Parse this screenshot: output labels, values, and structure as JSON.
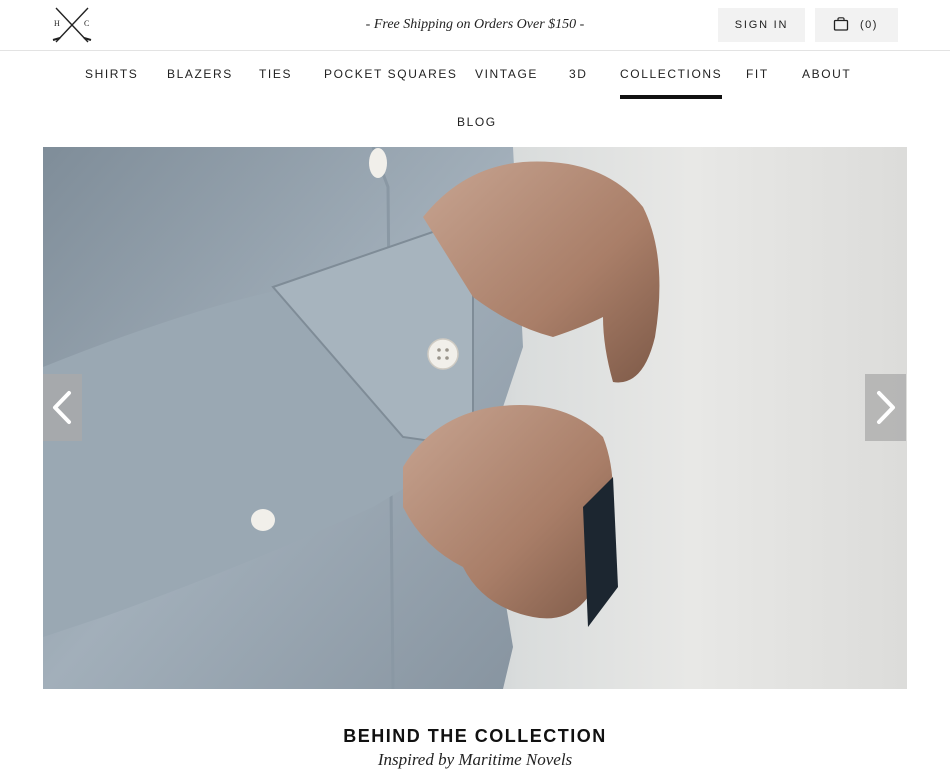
{
  "header": {
    "logo": {
      "letters": [
        "H",
        "C"
      ],
      "icon": "crossed-swords-logo"
    },
    "promo_text": "- Free Shipping on Orders Over $150 -",
    "sign_in_label": "SIGN IN",
    "cart": {
      "icon": "shopping-bag-icon",
      "count_label": "(0)"
    }
  },
  "nav": {
    "items": [
      {
        "label": "SHIRTS"
      },
      {
        "label": "BLAZERS"
      },
      {
        "label": "TIES"
      },
      {
        "label": "POCKET SQUARES"
      },
      {
        "label": "VINTAGE"
      },
      {
        "label": "3D"
      },
      {
        "label": "COLLECTIONS",
        "active": true
      },
      {
        "label": "FIT"
      },
      {
        "label": "ABOUT"
      },
      {
        "label": "BLOG"
      }
    ]
  },
  "hero": {
    "image_subject": "man buttoning light blue shirt cuff",
    "prev_icon": "chevron-left-icon",
    "next_icon": "chevron-right-icon"
  },
  "caption": {
    "title": "BEHIND THE COLLECTION",
    "subtitle": "Inspired by Maritime Novels"
  },
  "colors": {
    "text": "#222222",
    "active_underline": "#111111",
    "button_bg": "#f2f2f2",
    "divider": "#e3e3e3"
  }
}
